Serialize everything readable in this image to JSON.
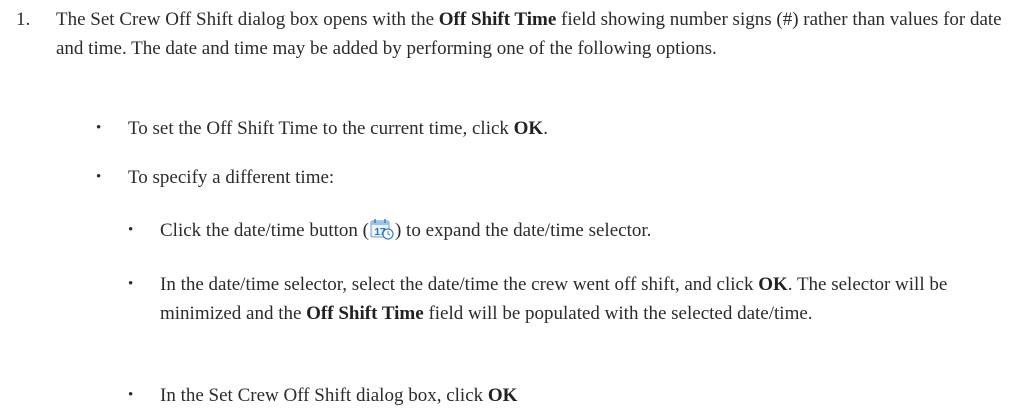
{
  "step": {
    "number": "1.",
    "intro": {
      "t1": "The Set Crew Off Shift dialog box opens with the ",
      "b1": "Off Shift Time",
      "t2": " field showing number signs (#) rather than values for date and time. The date and time may be added by performing one of the following options."
    },
    "options": [
      {
        "t1": "To set the Off Shift Time to the current time, click ",
        "b1": "OK",
        "t2": "."
      },
      {
        "t1": "To specify a different time:"
      }
    ],
    "sub_options": [
      {
        "t1": "Click the date/time button (",
        "icon": "calendar-clock-icon",
        "icon_text": "17",
        "t2": ") to expand the date/time selector."
      },
      {
        "t1": "In the date/time selector, select the date/time the crew went off shift, and click ",
        "b1": "OK",
        "t2": ". The selector will be minimized and the ",
        "b2": "Off Shift Time",
        "t3": " field will be populated with the selected date/time."
      },
      {
        "t1": "In the Set Crew Off Shift dialog box, click ",
        "b1": "OK"
      }
    ],
    "bullet_char": "•"
  }
}
